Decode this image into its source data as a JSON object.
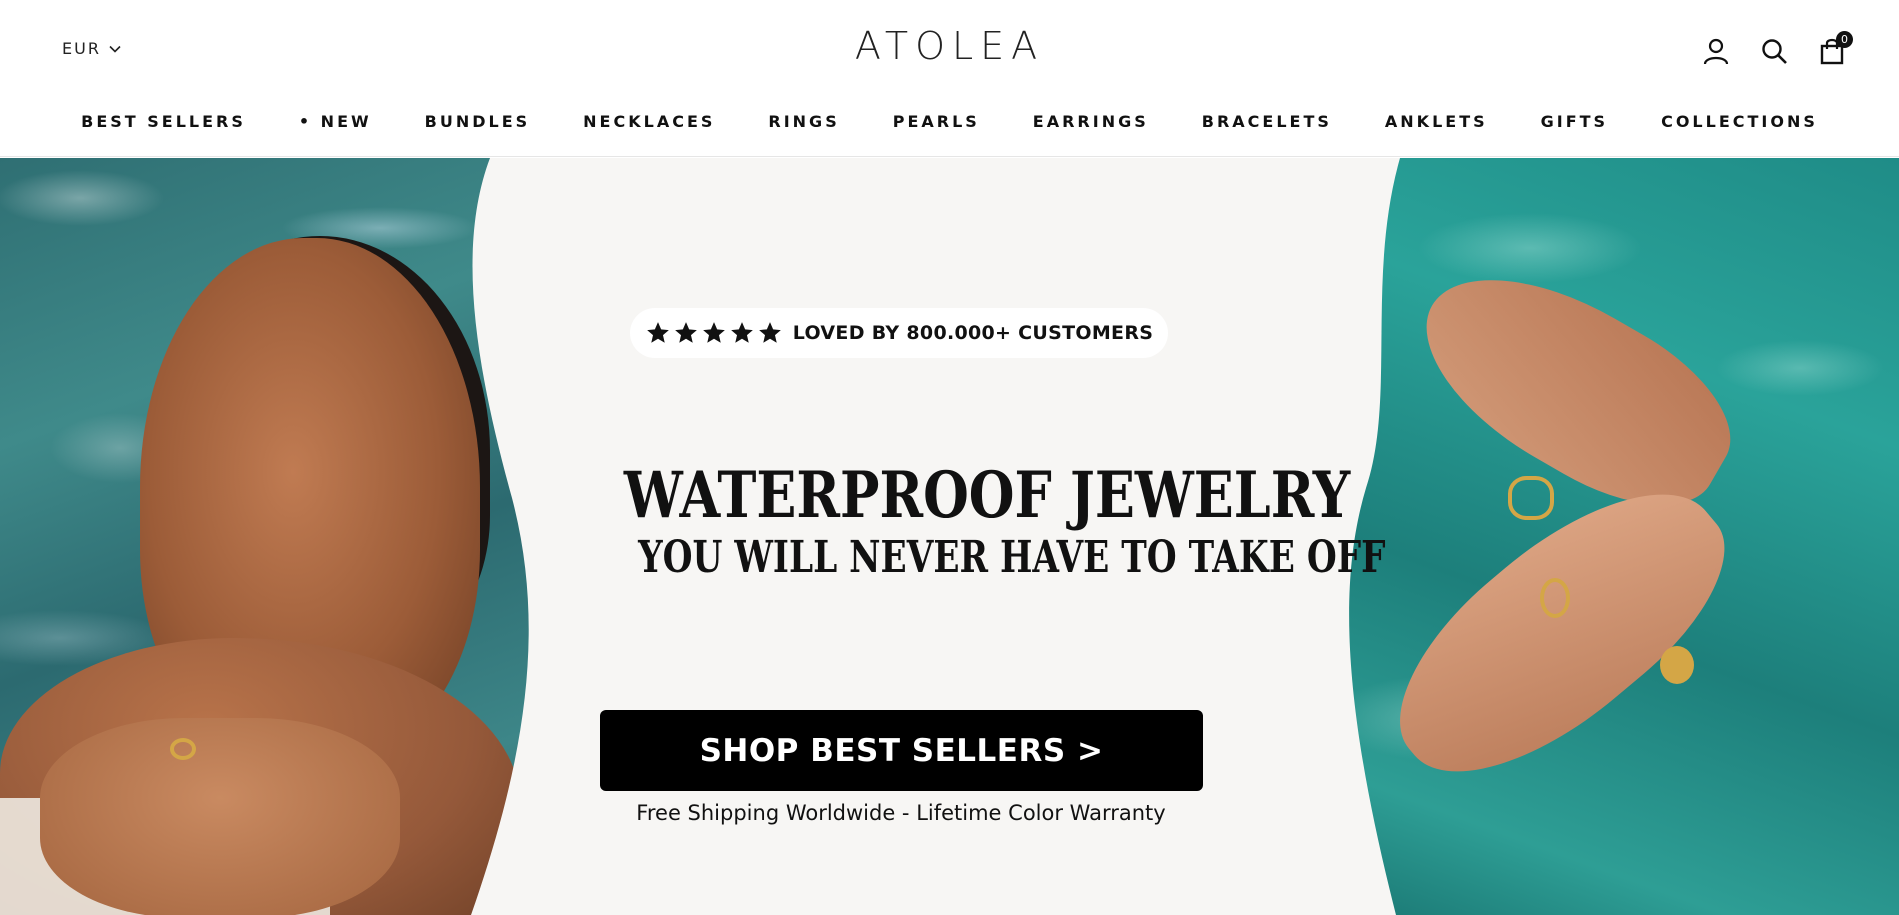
{
  "header": {
    "currency": "EUR",
    "logo": "ATOLEA",
    "cart_count": "0",
    "icons": [
      "account-icon",
      "search-icon",
      "cart-icon"
    ]
  },
  "nav": {
    "items": [
      {
        "label": "BEST SELLERS"
      },
      {
        "label": "• NEW"
      },
      {
        "label": "BUNDLES"
      },
      {
        "label": "NECKLACES"
      },
      {
        "label": "RINGS"
      },
      {
        "label": "PEARLS"
      },
      {
        "label": "EARRINGS"
      },
      {
        "label": "BRACELETS"
      },
      {
        "label": "ANKLETS"
      },
      {
        "label": "GIFTS"
      },
      {
        "label": "COLLECTIONS"
      }
    ]
  },
  "hero": {
    "rating_stars": 5,
    "badge_text": "LOVED BY 800.000+ CUSTOMERS",
    "headline_1": "WATERPROOF JEWELRY",
    "headline_2": "YOU WILL NEVER HAVE TO TAKE OFF",
    "cta_label": "SHOP BEST SELLERS >",
    "subline": "Free Shipping Worldwide  - Lifetime Color Warranty"
  },
  "colors": {
    "text": "#111111",
    "cta_bg": "#000000",
    "panel_bg": "#f7f6f4",
    "water_left": "#3f8a8a",
    "water_right": "#2aa39a",
    "gold": "#d4a646"
  }
}
